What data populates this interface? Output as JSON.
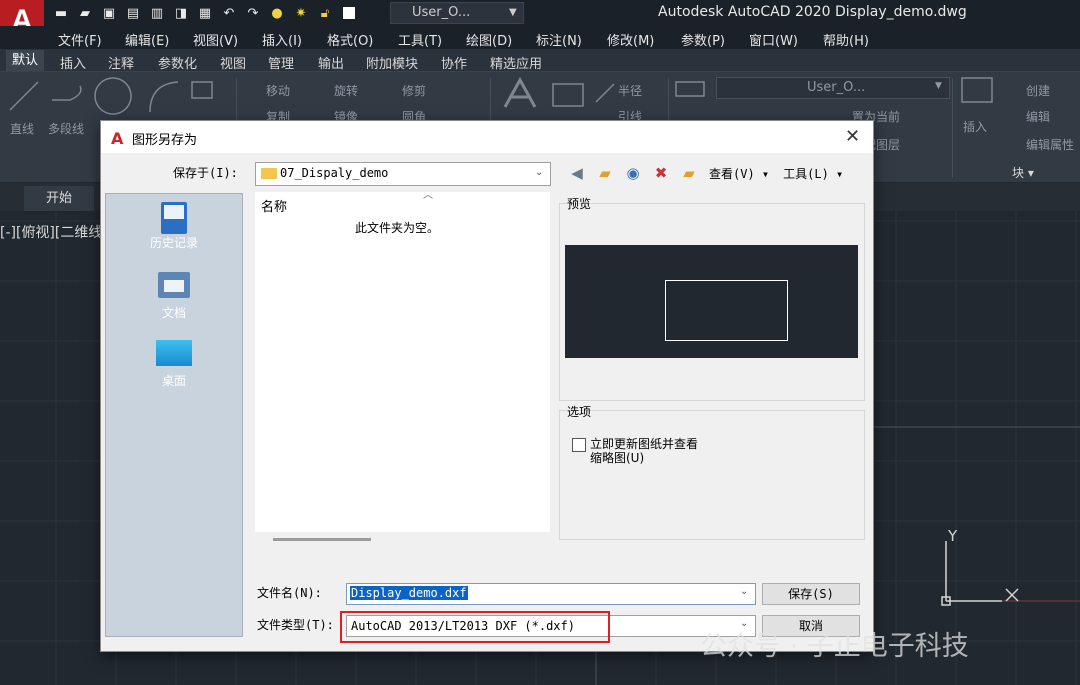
{
  "app": {
    "logo_letter": "A",
    "window_title": "Autodesk AutoCAD 2020    Display_demo.dwg",
    "layer_combo": "User_O..."
  },
  "menu": [
    "文件(F)",
    "编辑(E)",
    "视图(V)",
    "插入(I)",
    "格式(O)",
    "工具(T)",
    "绘图(D)",
    "标注(N)",
    "修改(M)",
    "参数(P)",
    "窗口(W)",
    "帮助(H)"
  ],
  "ribbon_tabs": [
    "默认",
    "插入",
    "注释",
    "参数化",
    "视图",
    "管理",
    "输出",
    "附加模块",
    "协作",
    "精选应用"
  ],
  "ribbon": {
    "draw_tools": [
      "直线",
      "多段线"
    ],
    "modify_tools": [
      "移动",
      "旋转",
      "修剪",
      "复制",
      "镜像",
      "圆角"
    ],
    "annot_tools": [
      "半径",
      "引线"
    ],
    "layer_combo": "User_O...",
    "layer_tools": [
      "置为当前",
      "匹配图层"
    ],
    "block_tools": [
      "插入",
      "创建",
      "编辑",
      "编辑属性"
    ],
    "block_panel": "块"
  },
  "file_tab": "开始",
  "viewport_label": "[-][俯视][二维线",
  "dialog": {
    "title": "图形另存为",
    "save_in_label": "保存于(I):",
    "save_in_value": "07_Dispaly_demo",
    "view_menu": "查看(V)",
    "tools_menu": "工具(L)",
    "places": [
      "历史记录",
      "文档",
      "桌面"
    ],
    "column_name": "名称",
    "empty_message": "此文件夹为空。",
    "preview_label": "预览",
    "options_label": "选项",
    "option_checkbox": "立即更新图纸并查看缩略图(U)",
    "option_checked": false,
    "filename_label": "文件名(N):",
    "filename_value": "Display_demo.dxf",
    "filetype_label": "文件类型(T):",
    "filetype_value": "AutoCAD 2013/LT2013 DXF (*.dxf)",
    "save_button": "保存(S)",
    "cancel_button": "取消"
  },
  "axis": {
    "y": "Y",
    "x": "X"
  },
  "watermark": "公众号 · 子正电子科技",
  "colors": {
    "logo_red": "#b81d22",
    "highlight_red": "#e02020",
    "selection_blue": "#0a64c8",
    "canvas": "#212830"
  }
}
